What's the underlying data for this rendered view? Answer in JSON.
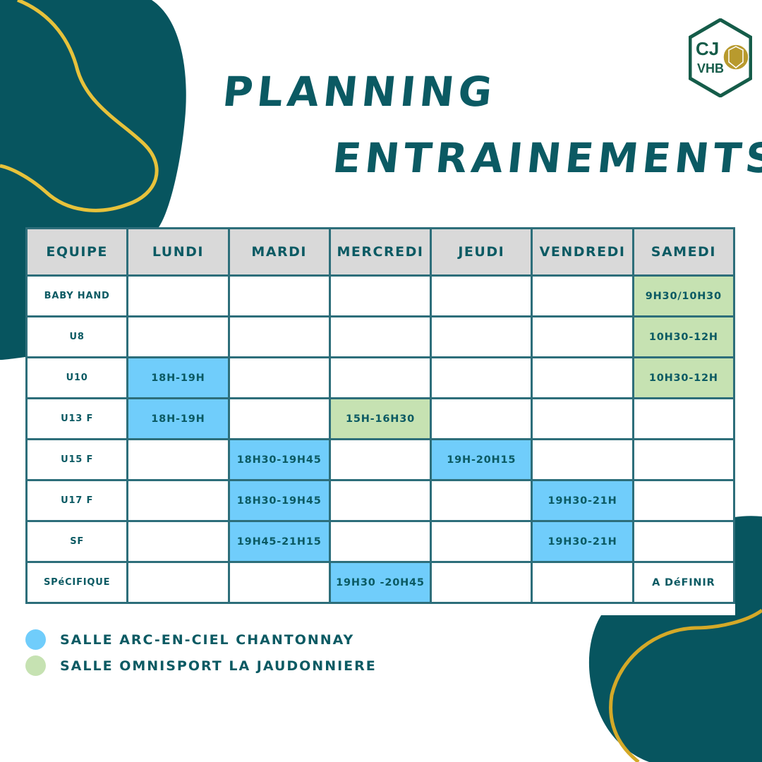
{
  "colors": {
    "primary_teal": "#07555f",
    "accent_gold": "#e7c23b",
    "header_gray": "#d9d9d9",
    "grid_border": "#2d6e7a",
    "salle_blue": "#70cdfb",
    "salle_green": "#c6e2b2"
  },
  "logo": {
    "line1": "CJ",
    "line2": "VHB",
    "icon": "handball-icon"
  },
  "title": {
    "line1": "PLANNING",
    "line2": "ENTRAINEMENTS"
  },
  "table": {
    "headers": [
      "EQUIPE",
      "LUNDI",
      "MARDI",
      "MERCREDI",
      "JEUDI",
      "VENDREDI",
      "SAMEDI"
    ],
    "rows": [
      {
        "team": "BABY HAND",
        "cells": [
          {
            "text": "",
            "salle": ""
          },
          {
            "text": "",
            "salle": ""
          },
          {
            "text": "",
            "salle": ""
          },
          {
            "text": "",
            "salle": ""
          },
          {
            "text": "",
            "salle": ""
          },
          {
            "text": "9H30/10H30",
            "salle": "green"
          }
        ]
      },
      {
        "team": "U8",
        "cells": [
          {
            "text": "",
            "salle": ""
          },
          {
            "text": "",
            "salle": ""
          },
          {
            "text": "",
            "salle": ""
          },
          {
            "text": "",
            "salle": ""
          },
          {
            "text": "",
            "salle": ""
          },
          {
            "text": "10H30-12H",
            "salle": "green"
          }
        ]
      },
      {
        "team": "U10",
        "cells": [
          {
            "text": "18H-19H",
            "salle": "blue"
          },
          {
            "text": "",
            "salle": ""
          },
          {
            "text": "",
            "salle": ""
          },
          {
            "text": "",
            "salle": ""
          },
          {
            "text": "",
            "salle": ""
          },
          {
            "text": "10H30-12H",
            "salle": "green"
          }
        ]
      },
      {
        "team": "U13 F",
        "cells": [
          {
            "text": "18H-19H",
            "salle": "blue"
          },
          {
            "text": "",
            "salle": ""
          },
          {
            "text": "15H-16H30",
            "salle": "green"
          },
          {
            "text": "",
            "salle": ""
          },
          {
            "text": "",
            "salle": ""
          },
          {
            "text": "",
            "salle": ""
          }
        ]
      },
      {
        "team": "U15 F",
        "cells": [
          {
            "text": "",
            "salle": ""
          },
          {
            "text": "18H30-19H45",
            "salle": "blue"
          },
          {
            "text": "",
            "salle": ""
          },
          {
            "text": "19H-20H15",
            "salle": "blue"
          },
          {
            "text": "",
            "salle": ""
          },
          {
            "text": "",
            "salle": ""
          }
        ]
      },
      {
        "team": "U17 F",
        "cells": [
          {
            "text": "",
            "salle": ""
          },
          {
            "text": "18H30-19H45",
            "salle": "blue"
          },
          {
            "text": "",
            "salle": ""
          },
          {
            "text": "",
            "salle": ""
          },
          {
            "text": "19H30-21H",
            "salle": "blue"
          },
          {
            "text": "",
            "salle": ""
          }
        ]
      },
      {
        "team": "SF",
        "cells": [
          {
            "text": "",
            "salle": ""
          },
          {
            "text": "19H45-21H15",
            "salle": "blue"
          },
          {
            "text": "",
            "salle": ""
          },
          {
            "text": "",
            "salle": ""
          },
          {
            "text": "19H30-21H",
            "salle": "blue"
          },
          {
            "text": "",
            "salle": ""
          }
        ]
      },
      {
        "team": "SPéCIFIQUE",
        "cells": [
          {
            "text": "",
            "salle": ""
          },
          {
            "text": "",
            "salle": ""
          },
          {
            "text": "19H30 -20H45",
            "salle": "blue"
          },
          {
            "text": "",
            "salle": ""
          },
          {
            "text": "",
            "salle": ""
          },
          {
            "text": "A DéFINIR",
            "salle": ""
          }
        ]
      }
    ]
  },
  "legend": [
    {
      "label": "SALLE ARC-EN-CIEL CHANTONNAY",
      "salle": "blue"
    },
    {
      "label": "SALLE OMNISPORT LA JAUDONNIERE",
      "salle": "green"
    }
  ]
}
